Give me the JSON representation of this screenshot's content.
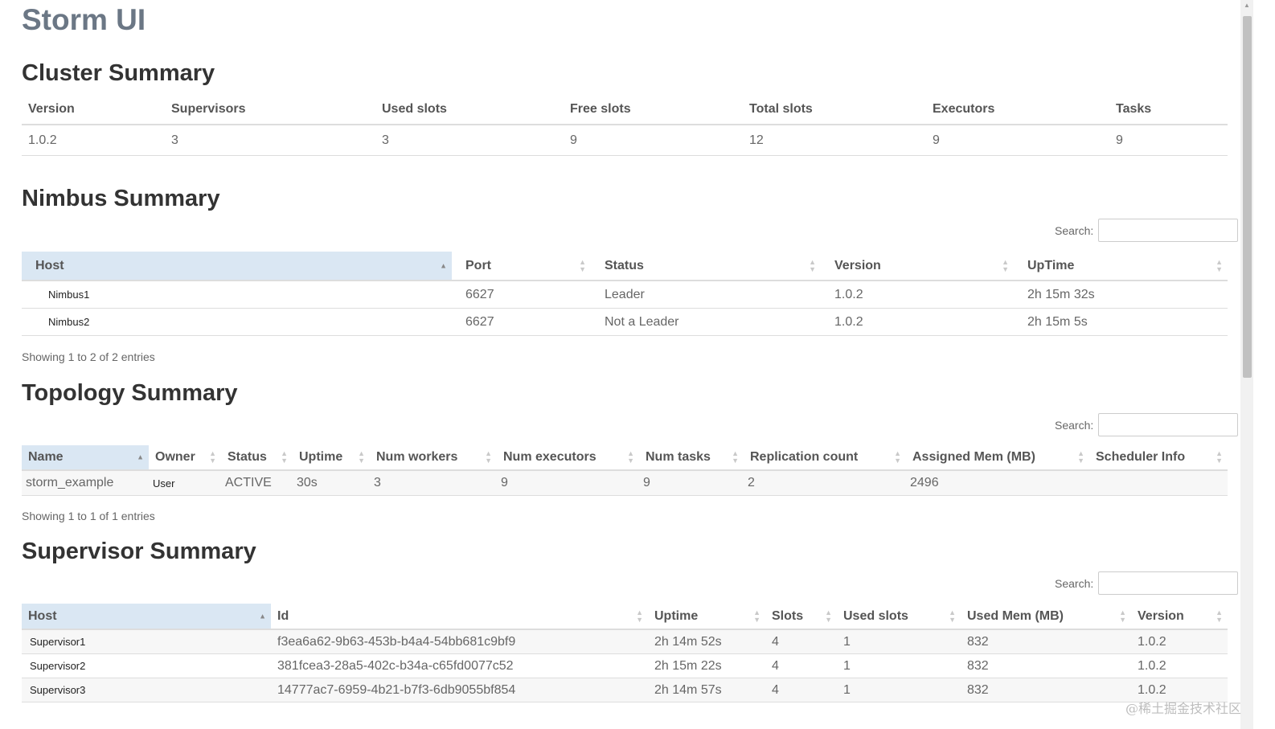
{
  "app": {
    "title": "Storm UI"
  },
  "cluster": {
    "heading": "Cluster Summary",
    "columns": [
      "Version",
      "Supervisors",
      "Used slots",
      "Free slots",
      "Total slots",
      "Executors",
      "Tasks"
    ],
    "row": [
      "1.0.2",
      "3",
      "3",
      "9",
      "12",
      "9",
      "9"
    ]
  },
  "nimbus": {
    "heading": "Nimbus Summary",
    "search_label": "Search:",
    "columns": [
      "Host",
      "Port",
      "Status",
      "Version",
      "UpTime"
    ],
    "rows": [
      [
        "Nimbus1",
        "6627",
        "Leader",
        "1.0.2",
        "2h 15m 32s"
      ],
      [
        "Nimbus2",
        "6627",
        "Not a Leader",
        "1.0.2",
        "2h 15m 5s"
      ]
    ],
    "info": "Showing 1 to 2 of 2 entries"
  },
  "topology": {
    "heading": "Topology Summary",
    "search_label": "Search:",
    "columns": [
      "Name",
      "Owner",
      "Status",
      "Uptime",
      "Num workers",
      "Num executors",
      "Num tasks",
      "Replication count",
      "Assigned Mem (MB)",
      "Scheduler Info"
    ],
    "rows": [
      [
        "storm_example",
        "User",
        "ACTIVE",
        "30s",
        "3",
        "9",
        "9",
        "2",
        "2496",
        ""
      ]
    ],
    "info": "Showing 1 to 1 of 1 entries"
  },
  "supervisor": {
    "heading": "Supervisor Summary",
    "search_label": "Search:",
    "columns": [
      "Host",
      "Id",
      "Uptime",
      "Slots",
      "Used slots",
      "Used Mem (MB)",
      "Version"
    ],
    "rows": [
      [
        "Supervisor1",
        "f3ea6a62-9b63-453b-b4a4-54bb681c9bf9",
        "2h 14m 52s",
        "4",
        "1",
        "832",
        "1.0.2"
      ],
      [
        "Supervisor2",
        "381fcea3-28a5-402c-b34a-c65fd0077c52",
        "2h 15m 22s",
        "4",
        "1",
        "832",
        "1.0.2"
      ],
      [
        "Supervisor3",
        "14777ac7-6959-4b21-b7f3-6db9055bf854",
        "2h 14m 57s",
        "4",
        "1",
        "832",
        "1.0.2"
      ]
    ]
  },
  "watermark": "@稀土掘金技术社区",
  "icons": {
    "sort_asc": "sort-asc-icon",
    "sort_both": "sort-both-icon"
  }
}
